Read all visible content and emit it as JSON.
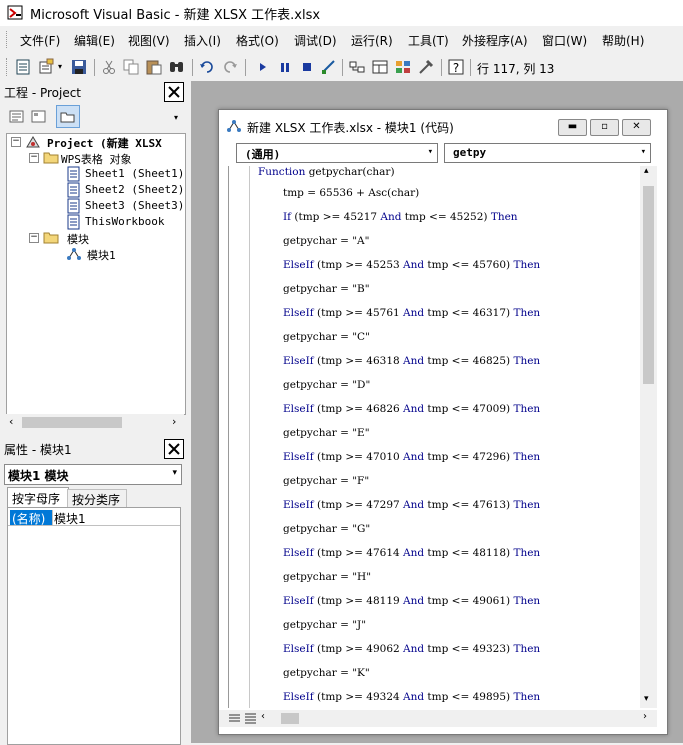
{
  "app": {
    "title": "Microsoft Visual Basic - 新建 XLSX 工作表.xlsx"
  },
  "menu": [
    "文件(F)",
    "编辑(E)",
    "视图(V)",
    "插入(I)",
    "格式(O)",
    "调试(D)",
    "运行(R)",
    "工具(T)",
    "外接程序(A)",
    "窗口(W)",
    "帮助(H)"
  ],
  "toolbar": {
    "cursor_position": "行 117, 列 13"
  },
  "project": {
    "title": "工程 - Project",
    "root": "Project (新建 XLSX",
    "folder_objects": "WPS表格 对象",
    "sheets": [
      "Sheet1 (Sheet1)",
      "Sheet2 (Sheet2)",
      "Sheet3 (Sheet3)",
      "ThisWorkbook"
    ],
    "folder_modules": "模块",
    "module": "模块1"
  },
  "properties": {
    "title": "属性 - 模块1",
    "object_combo": "模块1 模块",
    "tab_alpha": "按字母序",
    "tab_category": "按分类序",
    "prop_name": "(名称)",
    "prop_value": "模块1"
  },
  "code_window": {
    "title": "新建 XLSX 工作表.xlsx - 模块1 (代码)",
    "object_combo": "(通用)",
    "proc_combo": "getpy",
    "lines": [
      {
        "indent": 0,
        "kw": "Function",
        "rest": " getpychar(char)"
      },
      {
        "indent": 1,
        "kw": "",
        "rest": "tmp = 65536 + Asc(char)"
      },
      {
        "indent": 1,
        "kw": "If",
        "rest": " (tmp >= 45217 ",
        "kw2": "And",
        "rest2": " tmp <= 45252) ",
        "kw3": "Then"
      },
      {
        "indent": 1,
        "kw": "",
        "rest": "getpychar = \"A\""
      },
      {
        "indent": 1,
        "kw": "ElseIf",
        "rest": " (tmp >= 45253 ",
        "kw2": "And",
        "rest2": " tmp <= 45760) ",
        "kw3": "Then"
      },
      {
        "indent": 1,
        "kw": "",
        "rest": "getpychar = \"B\""
      },
      {
        "indent": 1,
        "kw": "ElseIf",
        "rest": " (tmp >= 45761 ",
        "kw2": "And",
        "rest2": " tmp <= 46317) ",
        "kw3": "Then"
      },
      {
        "indent": 1,
        "kw": "",
        "rest": "getpychar = \"C\""
      },
      {
        "indent": 1,
        "kw": "ElseIf",
        "rest": " (tmp >= 46318 ",
        "kw2": "And",
        "rest2": " tmp <= 46825) ",
        "kw3": "Then"
      },
      {
        "indent": 1,
        "kw": "",
        "rest": "getpychar = \"D\""
      },
      {
        "indent": 1,
        "kw": "ElseIf",
        "rest": " (tmp >= 46826 ",
        "kw2": "And",
        "rest2": " tmp <= 47009) ",
        "kw3": "Then"
      },
      {
        "indent": 1,
        "kw": "",
        "rest": "getpychar = \"E\""
      },
      {
        "indent": 1,
        "kw": "ElseIf",
        "rest": " (tmp >= 47010 ",
        "kw2": "And",
        "rest2": " tmp <= 47296) ",
        "kw3": "Then"
      },
      {
        "indent": 1,
        "kw": "",
        "rest": "getpychar = \"F\""
      },
      {
        "indent": 1,
        "kw": "ElseIf",
        "rest": " (tmp >= 47297 ",
        "kw2": "And",
        "rest2": " tmp <= 47613) ",
        "kw3": "Then"
      },
      {
        "indent": 1,
        "kw": "",
        "rest": "getpychar = \"G\""
      },
      {
        "indent": 1,
        "kw": "ElseIf",
        "rest": " (tmp >= 47614 ",
        "kw2": "And",
        "rest2": " tmp <= 48118) ",
        "kw3": "Then"
      },
      {
        "indent": 1,
        "kw": "",
        "rest": "getpychar = \"H\""
      },
      {
        "indent": 1,
        "kw": "ElseIf",
        "rest": " (tmp >= 48119 ",
        "kw2": "And",
        "rest2": " tmp <= 49061) ",
        "kw3": "Then"
      },
      {
        "indent": 1,
        "kw": "",
        "rest": "getpychar = \"J\""
      },
      {
        "indent": 1,
        "kw": "ElseIf",
        "rest": " (tmp >= 49062 ",
        "kw2": "And",
        "rest2": " tmp <= 49323) ",
        "kw3": "Then"
      },
      {
        "indent": 1,
        "kw": "",
        "rest": "getpychar = \"K\""
      },
      {
        "indent": 1,
        "kw": "ElseIf",
        "rest": " (tmp >= 49324 ",
        "kw2": "And",
        "rest2": " tmp <= 49895) ",
        "kw3": "Then"
      }
    ]
  },
  "colors": {
    "keyword": "#00008b",
    "mdi_background": "#ababab"
  }
}
